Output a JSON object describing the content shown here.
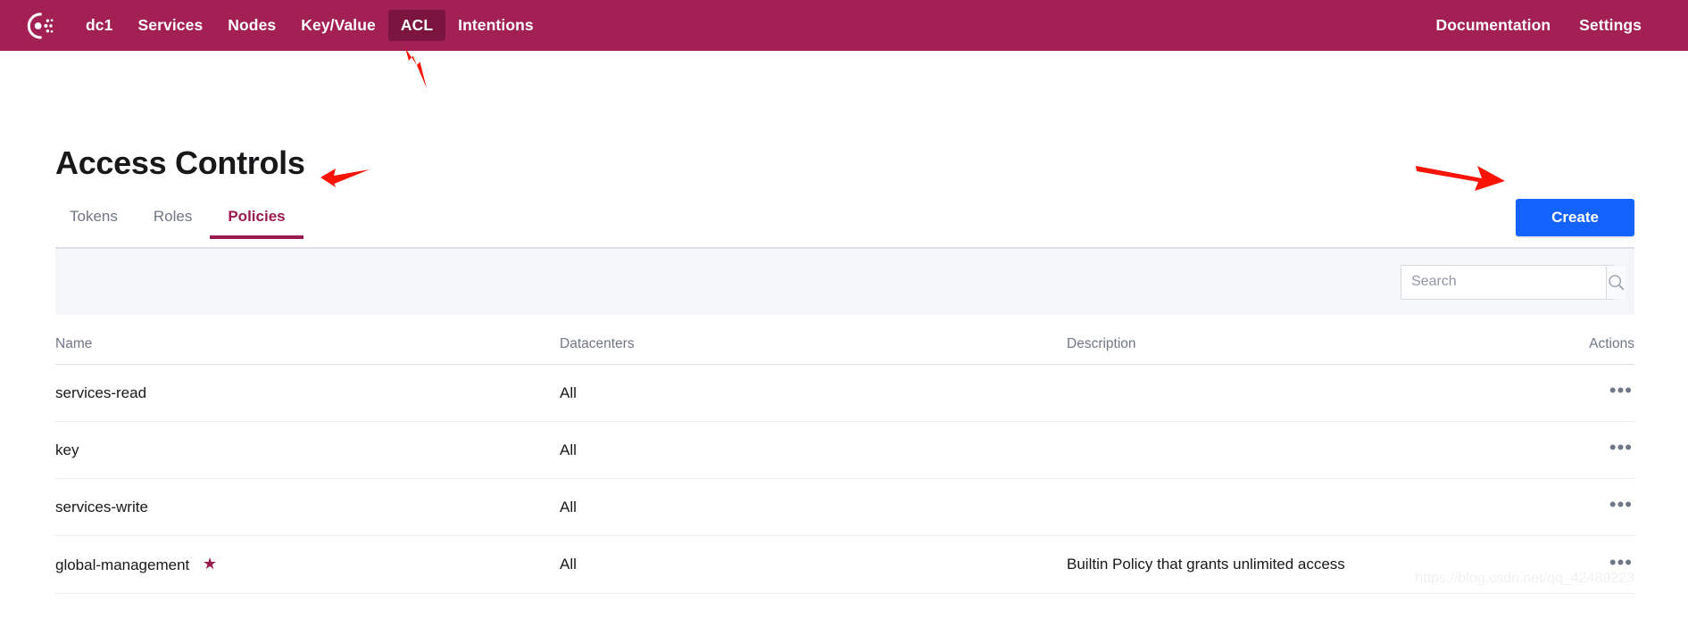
{
  "navbar": {
    "logo_icon": "consul-logo-icon",
    "background_color": "#a22054",
    "active_background_color": "#7b1540",
    "left_items": [
      {
        "label": "dc1",
        "active": false
      },
      {
        "label": "Services",
        "active": false
      },
      {
        "label": "Nodes",
        "active": false
      },
      {
        "label": "Key/Value",
        "active": false
      },
      {
        "label": "ACL",
        "active": true
      },
      {
        "label": "Intentions",
        "active": false
      }
    ],
    "right_items": [
      {
        "label": "Documentation"
      },
      {
        "label": "Settings"
      }
    ]
  },
  "page": {
    "title": "Access Controls"
  },
  "tabs": [
    {
      "label": "Tokens",
      "active": false
    },
    {
      "label": "Roles",
      "active": false
    },
    {
      "label": "Policies",
      "active": true
    }
  ],
  "actions": {
    "create_label": "Create",
    "create_color": "#1563ff"
  },
  "search": {
    "value": "",
    "placeholder": "Search",
    "button_icon": "search-icon"
  },
  "table": {
    "columns": [
      "Name",
      "Datacenters",
      "Description",
      "Actions"
    ],
    "rows": [
      {
        "name": "services-read",
        "starred": false,
        "datacenters": "All",
        "description": "",
        "actions_icon": "kebab-menu-icon",
        "actions_label": "•••"
      },
      {
        "name": "key",
        "starred": false,
        "datacenters": "All",
        "description": "",
        "actions_icon": "kebab-menu-icon",
        "actions_label": "•••"
      },
      {
        "name": "services-write",
        "starred": false,
        "datacenters": "All",
        "description": "",
        "actions_icon": "kebab-menu-icon",
        "actions_label": "•••"
      },
      {
        "name": "global-management",
        "starred": true,
        "star_glyph": "★",
        "datacenters": "All",
        "description": "Builtin Policy that grants unlimited access",
        "actions_icon": "kebab-menu-icon",
        "actions_label": "•••"
      }
    ]
  },
  "annotations": {
    "color": "#fa1405",
    "arrow_acl": "arrow-pointing-to-acl-nav",
    "arrow_policies_tab": "arrow-pointing-to-policies-tab",
    "arrow_create": "arrow-pointing-to-create-button"
  },
  "watermark": {
    "text": "https://blog.csdn.net/qq_42489223"
  }
}
